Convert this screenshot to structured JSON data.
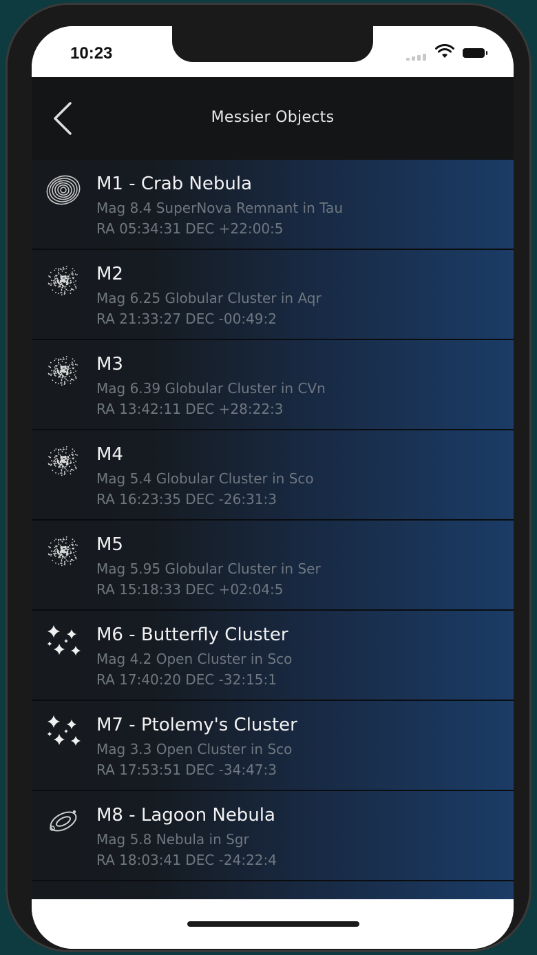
{
  "status_bar": {
    "time": "10:23"
  },
  "nav": {
    "title": "Messier Objects"
  },
  "objects": [
    {
      "name": "M1 - Crab Nebula",
      "desc": "Mag 8.4 SuperNova Remnant in Tau",
      "coords": "RA 05:34:31 DEC +22:00:5",
      "icon": "nebula-spiral-icon"
    },
    {
      "name": "M2",
      "desc": "Mag 6.25 Globular Cluster in Aqr",
      "coords": "RA 21:33:27 DEC -00:49:2",
      "icon": "globular-cluster-icon"
    },
    {
      "name": "M3",
      "desc": "Mag 6.39 Globular Cluster in CVn",
      "coords": "RA 13:42:11 DEC +28:22:3",
      "icon": "globular-cluster-icon"
    },
    {
      "name": "M4",
      "desc": "Mag 5.4 Globular Cluster in Sco",
      "coords": "RA 16:23:35 DEC -26:31:3",
      "icon": "globular-cluster-icon"
    },
    {
      "name": "M5",
      "desc": "Mag 5.95 Globular Cluster in Ser",
      "coords": "RA 15:18:33 DEC +02:04:5",
      "icon": "globular-cluster-icon"
    },
    {
      "name": "M6 - Butterfly Cluster",
      "desc": "Mag 4.2 Open Cluster in Sco",
      "coords": "RA 17:40:20 DEC -32:15:1",
      "icon": "open-cluster-icon"
    },
    {
      "name": "M7 - Ptolemy's Cluster",
      "desc": "Mag 3.3 Open Cluster in Sco",
      "coords": "RA 17:53:51 DEC -34:47:3",
      "icon": "open-cluster-icon"
    },
    {
      "name": "M8 - Lagoon Nebula",
      "desc": "Mag 5.8 Nebula in Sgr",
      "coords": "RA 18:03:41 DEC -24:22:4",
      "icon": "nebula-icon"
    }
  ]
}
